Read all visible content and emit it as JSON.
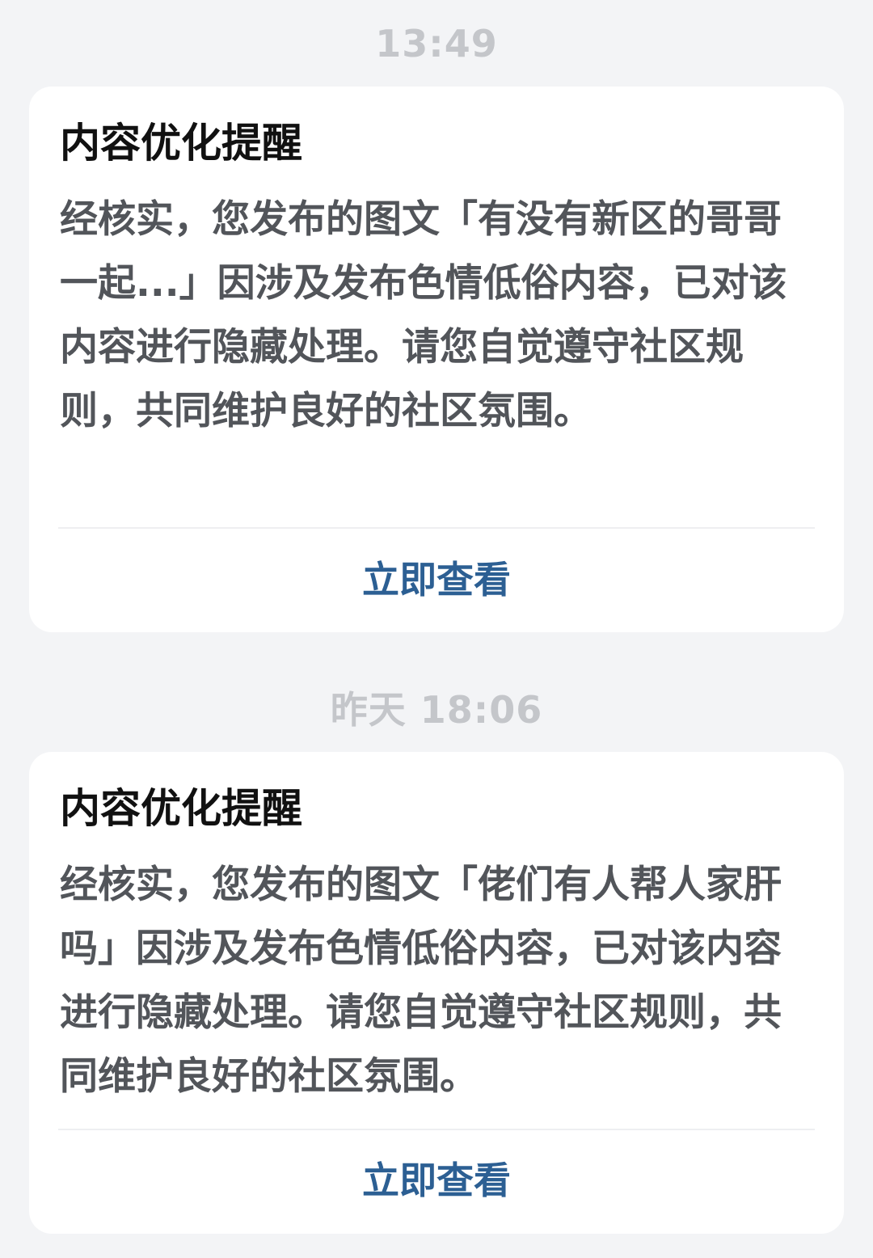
{
  "messages": [
    {
      "timestamp": "13:49",
      "title": "内容优化提醒",
      "body": "经核实，您发布的图文「有没有新区的哥哥一起...」因涉及发布色情低俗内容，已对该内容进行隐藏处理。请您自觉遵守社区规则，共同维护良好的社区氛围。",
      "action_label": "立即查看"
    },
    {
      "timestamp": "昨天  18:06",
      "title": "内容优化提醒",
      "body": "经核实，您发布的图文「佬们有人帮人家肝吗」因涉及发布色情低俗内容，已对该内容进行隐藏处理。请您自觉遵守社区规则，共同维护良好的社区氛围。",
      "action_label": "立即查看"
    }
  ],
  "colors": {
    "background": "#f3f4f6",
    "card": "#ffffff",
    "title": "#111111",
    "body": "#52555a",
    "timestamp": "#c4c6ca",
    "action": "#2c5f93"
  }
}
